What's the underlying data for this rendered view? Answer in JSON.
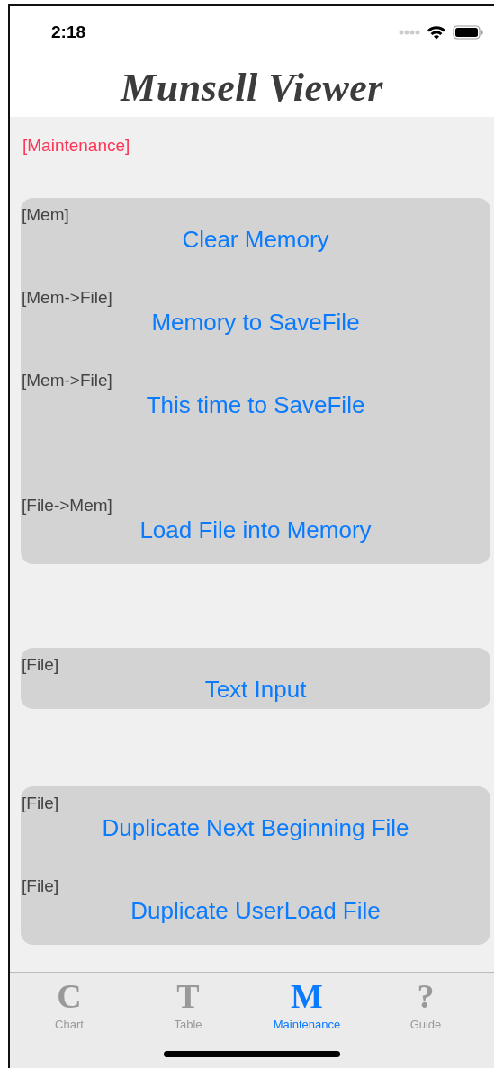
{
  "status_bar": {
    "time": "2:18"
  },
  "header": {
    "title": "Munsell Viewer"
  },
  "section_label": "[Maintenance]",
  "groups": [
    {
      "rows": [
        {
          "tag": "[Mem]",
          "button": "Clear Memory"
        },
        {
          "tag": "[Mem->File]",
          "button": "Memory to SaveFile"
        },
        {
          "tag": "[Mem->File]",
          "button": "This time to SaveFile"
        },
        {
          "tag": "[File->Mem]",
          "button": "Load File into Memory"
        }
      ]
    },
    {
      "rows": [
        {
          "tag": "[File]",
          "button": "Text Input"
        }
      ]
    },
    {
      "rows": [
        {
          "tag": "[File]",
          "button": "Duplicate Next Beginning File"
        },
        {
          "tag": "[File]",
          "button": "Duplicate UserLoad File"
        }
      ]
    }
  ],
  "tabs": [
    {
      "glyph": "C",
      "label": "Chart",
      "selected": false
    },
    {
      "glyph": "T",
      "label": "Table",
      "selected": false
    },
    {
      "glyph": "M",
      "label": "Maintenance",
      "selected": true
    },
    {
      "glyph": "?",
      "label": "Guide",
      "selected": false
    }
  ]
}
